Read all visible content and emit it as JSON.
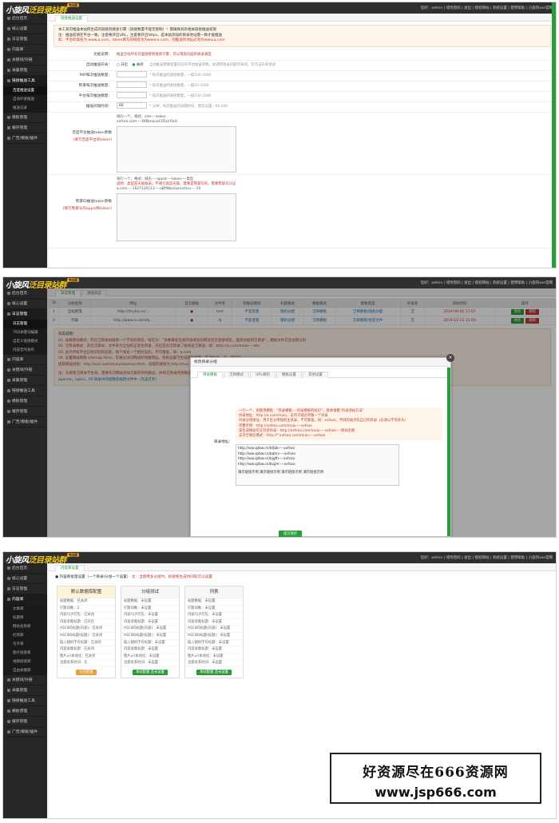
{
  "app": {
    "logo_main": "小旋风",
    "logo_sub": "泛目录站群",
    "logo_badge": "专业版",
    "toplinks": "您好：admin | 修改密码 | 退出 | 授权网站 | 系统设置 | 使用帮助 | 小旋风seo官网"
  },
  "panel1": {
    "sidebar": [
      {
        "label": "后台首页"
      },
      {
        "label": "核心设置"
      },
      {
        "label": "日志管理"
      },
      {
        "label": "内容库"
      },
      {
        "label": "关键词/外链"
      },
      {
        "label": "采集管理"
      },
      {
        "label": "链接推送工具",
        "open": true
      }
    ],
    "subitems": [
      {
        "label": "百度推送设置",
        "active": true
      },
      {
        "label": "自动外链推送"
      },
      {
        "label": "推送记录"
      }
    ],
    "sidebar_after": [
      {
        "label": "模板管理"
      },
      {
        "label": "缓存管理"
      },
      {
        "label": "广告/模板/插件"
      }
    ],
    "tab": "链接推送设置",
    "notice": [
      "本工具可推送本站所生成的链接到搜索引擎（链接数量不能无限制）！需确保具有相关链接推送权限",
      "注：推送前请在平台一致，注意要开启URL，注意要开启https，是本站添加的目录地址需一致才能推送",
      "如：平台的域名为 www.a.com，token填写的域名也为www.a.com，则推送的地址必须为www.a.com"
    ],
    "rows": [
      {
        "label": "功能说明：",
        "value": "推送全站所有页面链接到搜索引擎，可以增加页面的收录速度"
      },
      {
        "label": "自动推送开关：",
        "radio_on": "开启",
        "radio_off": "关闭",
        "value": "自动推送需要配置对应的平台推送参数，如遇到收录问题可关闭，可点击开关测试"
      },
      {
        "label": "MIP每次推送数量：",
        "value": "* 每次推送的链接数量，一般100-2000"
      },
      {
        "label": "熊掌每次推送数量：",
        "value": "* 每次推送的链接数量，一般10-1000"
      },
      {
        "label": "平台每次推送数量：",
        "value": "* 每次推送的链接数量，一般100-2000"
      },
      {
        "label": "推送间隔时间：",
        "input": "60",
        "value": "* 分钟，每次推送的间隔时间，建议设置：60-300"
      }
    ],
    "token_label": "百度平台推送token参数",
    "token_sub": "(填写百度平台的token)",
    "token_hint1": "每行一个，格式：site----token",
    "token_hint2": "xxfseo.com----XKNmouxC05zsYloH",
    "bear_label": "熊掌ID推送token参数",
    "bear_sub": "(填写熊掌号的appid和token)",
    "bear_hint1": "每行一个，格式：域名----appid----token----类型",
    "bear_hint2": "说明：类型是天级收录，不填写就是天级，需要是熊掌号的，需要熊掌号认证",
    "bear_hint3": "a.com----1627120112----aBYNbuGonncHcv----10"
  },
  "panel2": {
    "sidebar": [
      {
        "label": "后台首页"
      },
      {
        "label": "核心设置"
      },
      {
        "label": "日志管理",
        "open": true
      }
    ],
    "subitems": [
      {
        "label": "日志管理",
        "active": true
      },
      {
        "label": "TKD关键词编辑"
      },
      {
        "label": "自定义链接模式"
      },
      {
        "label": "内容定时发布"
      }
    ],
    "sidebar_after": [
      {
        "label": "内容库"
      },
      {
        "label": "关键词/外链"
      },
      {
        "label": "采集管理"
      },
      {
        "label": "链接推送工具"
      },
      {
        "label": "模板管理"
      },
      {
        "label": "缓存管理"
      },
      {
        "label": "广告/模板/插件"
      }
    ],
    "tabs": [
      {
        "label": "日志管理",
        "active": true
      },
      {
        "label": "添加日志"
      }
    ],
    "columns": [
      "ID",
      "分组名称",
      "网址",
      "首页模板",
      "文件夹",
      "伪静态模式",
      "标题模式",
      "模板模式",
      "模板类型",
      "外链池",
      "添加时间",
      "操作"
    ],
    "rows": [
      {
        "id": "1",
        "name": "全站爬虫",
        "url": "http://zhuhu.cn/...",
        "tpl": "●",
        "dir": "test",
        "rewrite": "不变变量",
        "title": "随机分配",
        "tmode": "泛目模板",
        "ttype": "泛目模板/随机分配",
        "pool": "泛",
        "time": "2019-08-02 17:07"
      },
      {
        "id": "0",
        "name": "列表",
        "url": "http://www.a.com/dj...",
        "tpl": "●",
        "dir": "dj",
        "rewrite": "不变变量",
        "title": "随机分配",
        "tmode": "泛目模板",
        "ttype": "泛目模板/指定文件",
        "pool": "泛",
        "time": "2019-12-13 15:00"
      }
    ],
    "edit": "修改",
    "del": "删除",
    "notice": [
      "日志说明：",
      "01. 站群建站模式：开启泛目录站群第一个不同的域名，域名为：“多数域名任意开放域名的网页首页直接域名，直接添加到泛目录”，模板文件在后台默认的",
      "02. 泛目录模式：开启泛目录，文件夹为全站的正常主目录，开启首页泛目录二级域名泛目录，如：http://a.com/mulu----abc",
      "03. 此外所有平台已经识别的前提，每个域名一个相对应的，不可重复，如：a.com",
      "04. 设置网站地图 sitemap.html，可通过访问网站的地图网址，系统设置可生成网站地图，每次生成一次，请提前",
      "提取网站链接：http://xxx.com/mulu/sitemap.html，提取的链接为 http://xxx.com/mulu/sitemap.html",
      "注：为避免泛目录不生效，需要先对网站添加泛解析和伪静态，并将泛目录的伪静态规则添加到服务器",
      "apache，nginx，IIS 目录中的伪静态规则文件中（点击打开）"
    ],
    "modal": {
      "title": "修改目录分组",
      "tabs": [
        "目录模板",
        "泛目模式",
        "URL规则",
        "模板设置",
        "其他设置"
      ],
      "lines": [
        "一行一个，如使用模板：“目录模板----目录模板的标识”，具体请看“目录添加方法”",
        "目录地址：http://a.com/mulu，支持子域名单独一个目录",
        "目录分组地址：用于区分单独的主目录，不可重复，如：xxfseo，不同的站点有自己的目录（必须以字母开头）",
        "完整示例：http://xxfseo.com/mulu----xxfseo",
        "该生成网站可支持多目录：http://xxfseo.com/mulu----xxfseo----网站名称",
        "支持全域名模式：http://*.xxfseo.com/mulu----xxfseo"
      ],
      "field_label": "目录地址：",
      "area_lines": [
        "http://ww.qzbw.cn/bfjbb----xxfseo",
        "http://ww.qzbw.cn/bqhiv----xxfseo",
        "http://ww.qzbw.cn/bjgfh----xxfseo",
        "http://ww.qzbw.cn/bcjjhl----xxfseo",
        "演示链接示例 演示链接示例 演示链接示例 演示链接示例"
      ],
      "save": "提交保存"
    }
  },
  "panel3": {
    "sidebar": [
      {
        "label": "后台首页"
      },
      {
        "label": "核心设置"
      },
      {
        "label": "日志管理"
      },
      {
        "label": "内容库",
        "open": true
      }
    ],
    "subitems": [
      {
        "label": "文章库"
      },
      {
        "label": "标题库"
      },
      {
        "label": "网站名称库"
      },
      {
        "label": "栏目库"
      },
      {
        "label": "句子库"
      },
      {
        "label": "图片链接库"
      },
      {
        "label": "视频链接库"
      },
      {
        "label": "自由关键库"
      }
    ],
    "sidebar_after": [
      {
        "label": "关键词/外链"
      },
      {
        "label": "采集管理"
      },
      {
        "label": "链接推送工具"
      },
      {
        "label": "模板管理"
      },
      {
        "label": "缓存管理"
      },
      {
        "label": "广告/模板/插件"
      }
    ],
    "tab": "内容库设置",
    "notice": "内容库批量设置（一个目录/分组一个设置）",
    "notice_red": "注：当使用多分组时，标题和生成时间就可以设置",
    "cards": [
      {
        "title": "默认数据库配置",
        "selected": true,
        "lines": [
          "标题数据：已关闭",
          "打散词数：2",
          "内容句子打乱：已关闭",
          "内容采集标题：已开启",
          "ASCII码标题(内容)：已关闭",
          "ASCII码标题(标题)：已关闭",
          "插入随机字符标题：已关闭",
          "内容采集标题：已关闭",
          "图片url本地化：已关闭",
          "主题关系时间：无"
        ],
        "btn": "已在配置"
      },
      {
        "title": "分组测试",
        "selected": false,
        "lines": [
          "标题数据：未设置",
          "打散词数：未设置",
          "内容句子打乱：未设置",
          "内容采集标题：未设置",
          "ASCII码标题(内容)：未设置",
          "ASCII码标题(标题)：未设置",
          "插入随机字符标题：未设置",
          "内容采集标题：未设置",
          "图片url本地化：未设置",
          "主题关系时间：未设置"
        ],
        "btn": "本站配置  还未设置"
      },
      {
        "title": "列表",
        "selected": false,
        "lines": [
          "标题数据：未设置",
          "打散词数：未设置",
          "内容句子打乱：未设置",
          "内容采集标题：未设置",
          "ASCII码标题(内容)：未设置",
          "ASCII码标题(标题)：未设置",
          "插入随机字符标题：未设置",
          "内容采集标题：未设置",
          "图片url本地化：未设置",
          "主题关系时间：未设置"
        ],
        "btn": "本站配置  还未设置"
      }
    ]
  },
  "watermark": {
    "line1": "好资源尽在666资源网",
    "line2": "www.jsp666.com"
  }
}
